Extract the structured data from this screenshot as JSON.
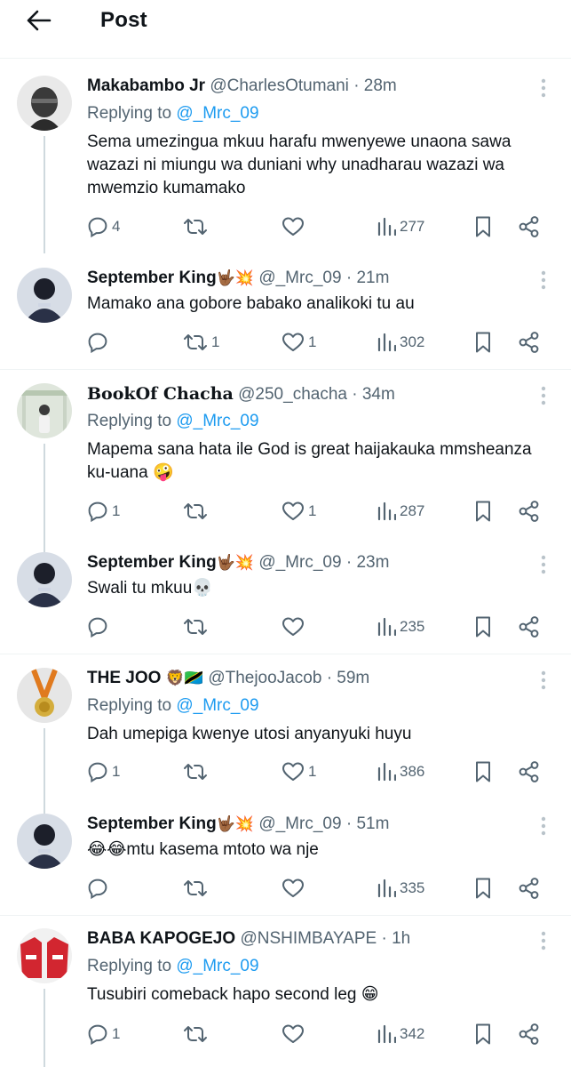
{
  "header": {
    "title": "Post"
  },
  "colors": {
    "accent": "#1d9bf0",
    "secondary_text": "#536471",
    "border": "#eff3f4",
    "thread_line": "#cfd9de"
  },
  "tweets": [
    {
      "name": "Makabambo Jr",
      "handle": "@CharlesOtumani",
      "time": "28m",
      "replying_prefix": "Replying to",
      "replying_to": "@_Mrc_09",
      "text": "Sema umezingua mkuu harafu mwenyewe unaona sawa wazazi ni miungu wa duniani why unadharau wazazi wa mwemzio kumamako",
      "replies": "4",
      "retweets": "",
      "likes": "",
      "views": "277"
    },
    {
      "name": "September King",
      "name_emoji": "🤟🏾💥",
      "handle": "@_Mrc_09",
      "time": "21m",
      "text": "Mamako ana gobore babako analikoki tu au",
      "replies": "",
      "retweets": "1",
      "likes": "1",
      "views": "302"
    },
    {
      "name": "BookOf Chacha",
      "handle": "@250_chacha",
      "time": "34m",
      "replying_prefix": "Replying to",
      "replying_to": "@_Mrc_09",
      "text": "Mapema sana hata ile God is great haijakauka mmsheanza ku-uana 🤪",
      "replies": "1",
      "retweets": "",
      "likes": "1",
      "views": "287"
    },
    {
      "name": "September King",
      "name_emoji": "🤟🏾💥",
      "handle": "@_Mrc_09",
      "time": "23m",
      "text": "Swali tu mkuu💀",
      "replies": "",
      "retweets": "",
      "likes": "",
      "views": "235"
    },
    {
      "name": "THE JOO",
      "name_emoji": "🦁🇹🇿",
      "handle": "@ThejooJacob",
      "time": "59m",
      "replying_prefix": "Replying to",
      "replying_to": "@_Mrc_09",
      "text": "Dah umepiga kwenye utosi anyanyuki huyu",
      "replies": "1",
      "retweets": "",
      "likes": "1",
      "views": "386"
    },
    {
      "name": "September King",
      "name_emoji": "🤟🏾💥",
      "handle": "@_Mrc_09",
      "time": "51m",
      "text": "😂😂mtu kasema mtoto wa nje",
      "replies": "",
      "retweets": "",
      "likes": "",
      "views": "335"
    },
    {
      "name": "BABA KAPOGEJO",
      "handle": "@NSHIMBAYAPE",
      "time": "1h",
      "replying_prefix": "Replying to",
      "replying_to": "@_Mrc_09",
      "text": "Tusubiri comeback hapo second leg 😁",
      "replies": "1",
      "retweets": "",
      "likes": "",
      "views": "342"
    }
  ]
}
